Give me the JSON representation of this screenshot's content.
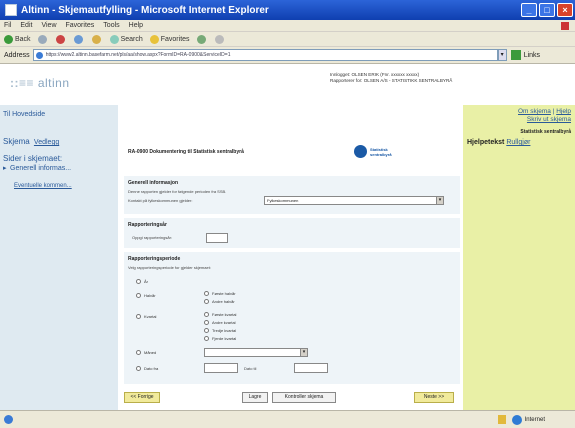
{
  "window": {
    "title": "Altinn - Skjemautfylling - Microsoft Internet Explorer"
  },
  "menu": [
    "Fil",
    "Edit",
    "View",
    "Favorites",
    "Tools",
    "Help"
  ],
  "toolbar": {
    "back": "Back",
    "search": "Search",
    "favorites": "Favorites"
  },
  "address": {
    "label": "Address",
    "url": "https://www2.altinn.basefarm.net/pls/aa/show.aspx?FormID=RA-0900&ServiceID=1",
    "links": "Links"
  },
  "header": {
    "logo": "altinn",
    "info_line1": "Innlogget: OLSEN ERIK (Fnr. xxxxxx xxxxx)",
    "info_line2": "Rapporterer for: OLSEN A/S - STATISTIKK SENTRALBYRÅ"
  },
  "sidebar": {
    "home": "Til Hovedside",
    "tab_active": "Skjema",
    "tab_link": "Vedlegg",
    "pages_title": "Sider i skjemaet:",
    "page1": "Generell informas...",
    "page2": "Eventuelle kommen..."
  },
  "main": {
    "form_title": "RA-0900 Dokumentering til Statistisk sentralbyrå",
    "ssb_logo": "Statistisk sentralbyrå",
    "general": {
      "heading": "Generell informasjon",
      "note": "Denne rapporten gjelder for følgende perioden fra SSB.",
      "reporter_label": "Kontakt på fylkeskommunen gjelder:",
      "reporter_value": "Fylkeskommunen"
    },
    "reporting": {
      "heading": "Rapporteringsår",
      "year_label": "Oppgi rapporteringsår:"
    },
    "period": {
      "heading": "Rapporteringsperiode",
      "note": "Velg rapporteringsperiode for gjelder skjemaet:",
      "options": {
        "year": "År",
        "half": "Halvår",
        "half_1": "Første halvår",
        "half_2": "Andre halvår",
        "quarter": "Kvartal",
        "q1": "Første kvartal",
        "q2": "Andre kvartal",
        "q3": "Tredje kvartal",
        "q4": "Fjerde kvartal",
        "month": "Måned",
        "date_range": "Dato fra",
        "date_to": "Dato til"
      }
    },
    "buttons": {
      "prev": "<< Forrige",
      "save": "Lagre",
      "check": "Kontroller skjema",
      "next": "Neste >>"
    }
  },
  "rightpanel": {
    "link1": "Om skjema",
    "link2": "Hjelp",
    "link3": "Skriv ut skjema",
    "org": "Statistisk sentralbyrå",
    "help_label": "Hjelpetekst",
    "help_link": "Rullgjør"
  },
  "statusbar": {
    "zone": "Internet"
  }
}
